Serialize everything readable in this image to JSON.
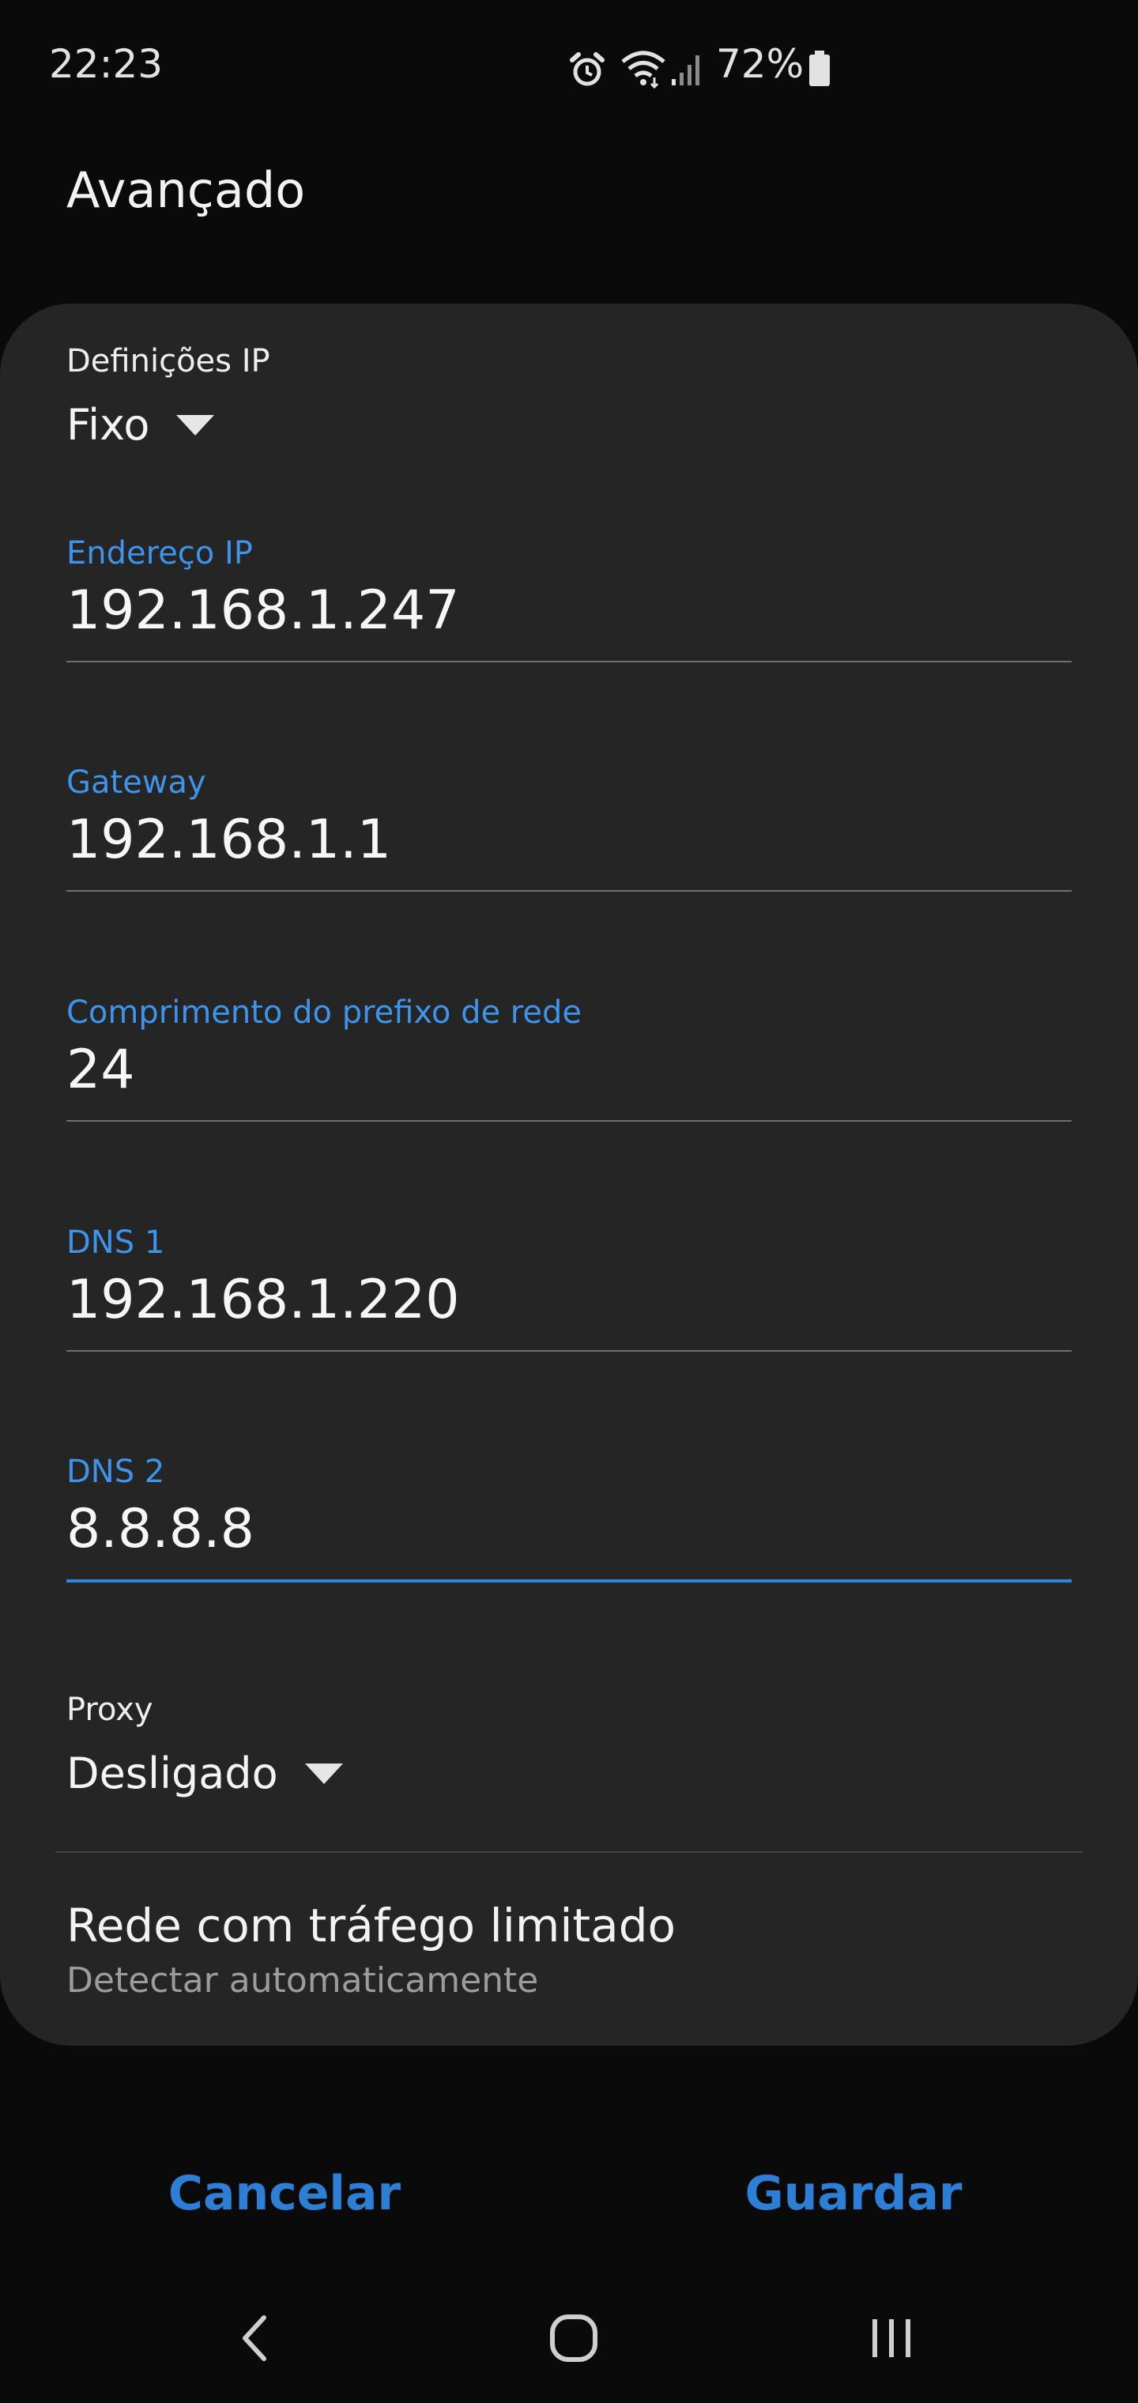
{
  "status_bar": {
    "time": "22:23",
    "battery_percent": "72%",
    "icons": [
      "alarm-icon",
      "wifi-icon",
      "signal-icon",
      "battery-icon"
    ]
  },
  "header": {
    "title": "Avançado"
  },
  "ip_settings": {
    "label": "Definições IP",
    "value": "Fixo"
  },
  "fields": [
    {
      "label": "Endereço IP",
      "value": "192.168.1.247",
      "active": false
    },
    {
      "label": "Gateway",
      "value": "192.168.1.1",
      "active": false
    },
    {
      "label": "Comprimento do prefixo de rede",
      "value": "24",
      "active": false
    },
    {
      "label": "DNS 1",
      "value": "192.168.1.220",
      "active": false
    },
    {
      "label": "DNS 2",
      "value": "8.8.8.8",
      "active": true
    }
  ],
  "proxy": {
    "label": "Proxy",
    "value": "Desligado"
  },
  "metered": {
    "title": "Rede com tráfego limitado",
    "subtitle": "Detectar automaticamente"
  },
  "actions": {
    "cancel": "Cancelar",
    "save": "Guardar"
  },
  "colors": {
    "accent": "#3d94ea",
    "background": "#0a0a0a",
    "card": "#252525"
  }
}
